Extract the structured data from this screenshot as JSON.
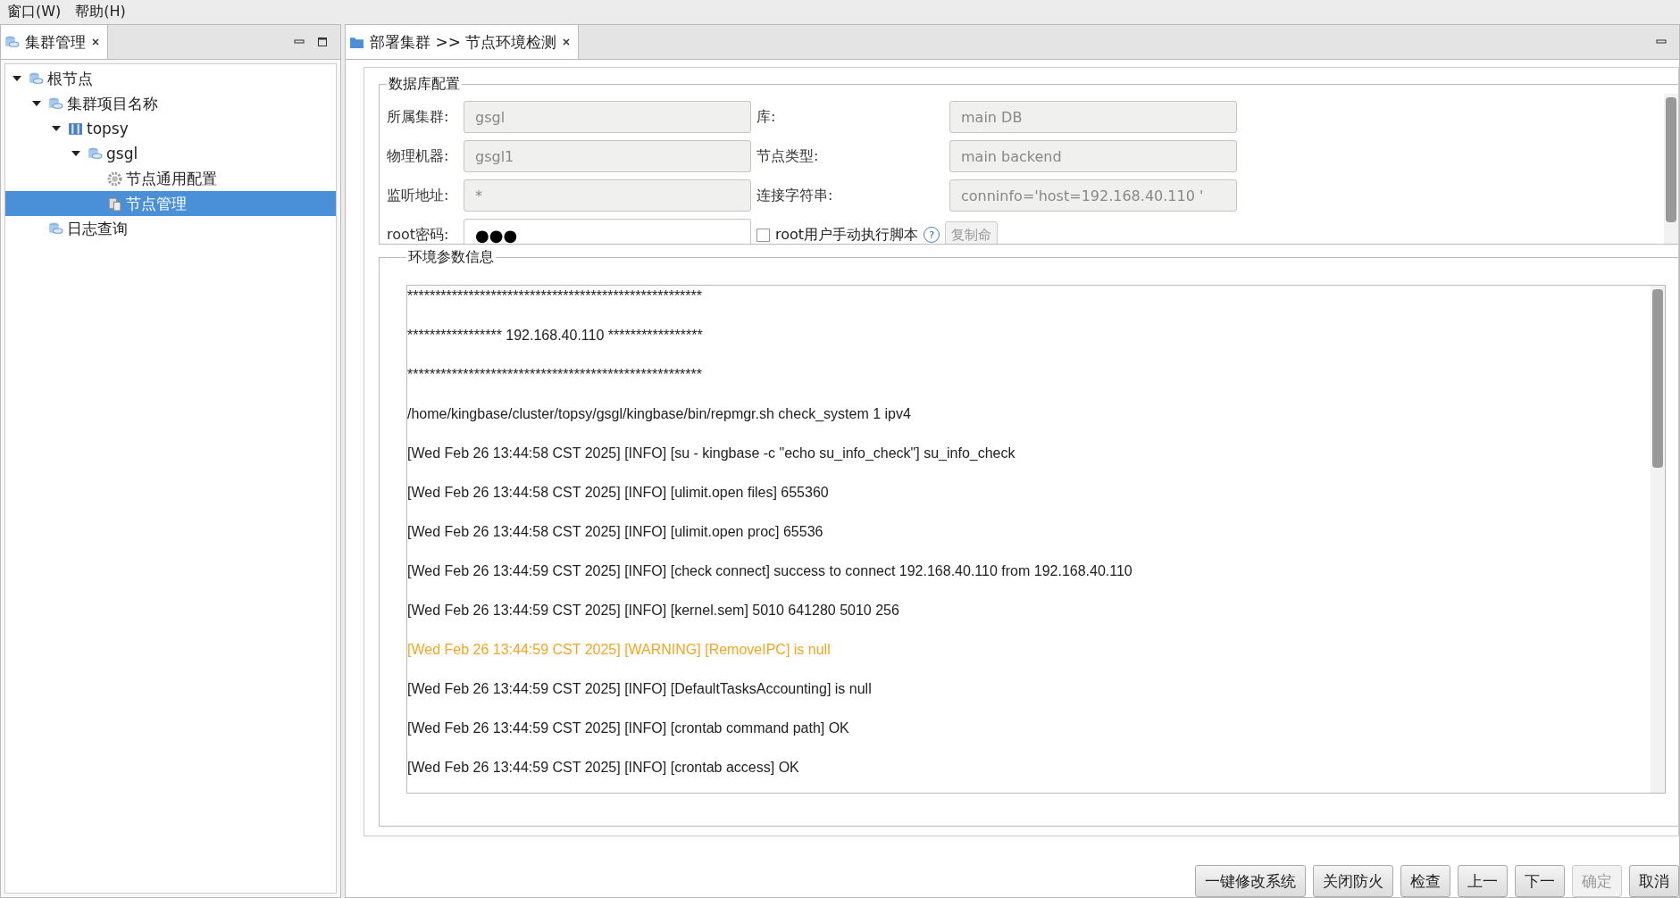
{
  "menu": [
    "窗口(W)",
    "帮助(H)"
  ],
  "left_panel": {
    "tab": {
      "title": "集群管理",
      "selected": true
    },
    "tree": [
      {
        "label": "根节点",
        "kind": "db",
        "expanded": true,
        "selected": false,
        "children": [
          {
            "label": "集群项目名称",
            "kind": "db",
            "expanded": true,
            "selected": false,
            "children": [
              {
                "label": "topsy",
                "kind": "server",
                "expanded": true,
                "selected": false,
                "children": [
                  {
                    "label": "gsgl",
                    "kind": "db",
                    "expanded": true,
                    "selected": false,
                    "children": [
                      {
                        "label": "节点通用配置",
                        "kind": "gear",
                        "selected": false
                      },
                      {
                        "label": "节点管理",
                        "kind": "node",
                        "selected": true
                      }
                    ]
                  }
                ]
              }
            ]
          },
          {
            "label": "日志查询",
            "kind": "db",
            "selected": false
          }
        ]
      }
    ]
  },
  "editor": {
    "tab": {
      "title": "部署集群 >> 节点环境检测",
      "selected": true
    },
    "db_config": {
      "title": "数据库配置",
      "fields": [
        {
          "label": "所属集群:",
          "value": "gsgl",
          "disabled": true
        },
        {
          "label": "库:",
          "value": "main DB",
          "disabled": true
        },
        {
          "label": "物理机器:",
          "value": "gsgl1",
          "disabled": true
        },
        {
          "label": "节点类型:",
          "value": "main backend",
          "disabled": true
        },
        {
          "label": "监听地址:",
          "value": "*",
          "disabled": true
        },
        {
          "label": "连接字符串:",
          "value": "conninfo='host=192.168.40.110 '",
          "disabled": true
        }
      ],
      "root_password": {
        "label": "root密码:",
        "value": "●●●"
      },
      "manual_script": {
        "label": "root用户手动执行脚本",
        "checked": false
      },
      "help": "?",
      "copy_button": {
        "label": "复制命",
        "disabled": true
      }
    },
    "env_info": {
      "title": "环境参数信息",
      "lines": [
        {
          "kind": "info",
          "text": "*****************************************************"
        },
        {
          "kind": "info",
          "text": "***************** 192.168.40.110 *****************"
        },
        {
          "kind": "info",
          "text": "*****************************************************"
        },
        {
          "kind": "info",
          "text": "/home/kingbase/cluster/topsy/gsgl/kingbase/bin/repmgr.sh check_system 1 ipv4"
        },
        {
          "kind": "info",
          "text": "[Wed Feb 26 13:44:58 CST 2025] [INFO] [su - kingbase -c \"echo su_info_check\"] su_info_check"
        },
        {
          "kind": "info",
          "text": "[Wed Feb 26 13:44:58 CST 2025] [INFO] [ulimit.open files] 655360"
        },
        {
          "kind": "info",
          "text": "[Wed Feb 26 13:44:58 CST 2025] [INFO] [ulimit.open proc] 65536"
        },
        {
          "kind": "info",
          "text": "[Wed Feb 26 13:44:59 CST 2025] [INFO] [check connect] success to connect 192.168.40.110 from 192.168.40.110"
        },
        {
          "kind": "info",
          "text": "[Wed Feb 26 13:44:59 CST 2025] [INFO] [kernel.sem] 5010 641280 5010 256"
        },
        {
          "kind": "warning",
          "text": "[Wed Feb 26 13:44:59 CST 2025] [WARNING] [RemoveIPC] is null"
        },
        {
          "kind": "info",
          "text": "[Wed Feb 26 13:44:59 CST 2025] [INFO] [DefaultTasksAccounting] is null"
        },
        {
          "kind": "info",
          "text": "[Wed Feb 26 13:44:59 CST 2025] [INFO] [crontab command path] OK"
        },
        {
          "kind": "info",
          "text": "[Wed Feb 26 13:44:59 CST 2025] [INFO] [crontab access] OK"
        }
      ]
    },
    "buttons": [
      {
        "label": "一键修改系统",
        "disabled": false
      },
      {
        "label": "关闭防火",
        "disabled": false
      },
      {
        "label": "检查",
        "disabled": false
      },
      {
        "label": "上一",
        "disabled": false
      },
      {
        "label": "下一",
        "disabled": false
      },
      {
        "label": "确定",
        "disabled": true
      },
      {
        "label": "取消",
        "disabled": false
      }
    ]
  }
}
